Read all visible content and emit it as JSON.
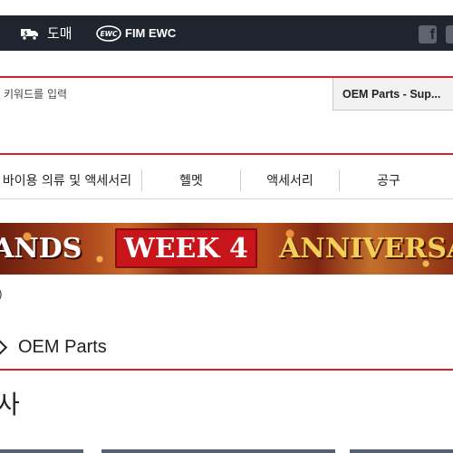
{
  "topbar": {
    "wholesale_label": "도매",
    "fimewc_logo": "EWC",
    "fimewc_label": "FIM EWC",
    "social": [
      {
        "icon": "facebook-icon",
        "glyph": "f"
      },
      {
        "icon": "instagram-icon",
        "glyph": ""
      }
    ]
  },
  "search": {
    "placeholder": "키워드를 입력",
    "scope_value": "OEM Parts - Sup..."
  },
  "categories": [
    "바이용 의류 및 액세서리",
    "헬멧",
    "액세서리",
    "공구"
  ],
  "banner": {
    "left_text": "ANDS",
    "week_text": "WEEK 4",
    "right_text": "ANNIVERSAR"
  },
  "note": ")",
  "section": {
    "title": "OEM Parts"
  },
  "heading_char": "사",
  "colors": {
    "accent": "#d4232a",
    "topbar": "#1f252f"
  }
}
